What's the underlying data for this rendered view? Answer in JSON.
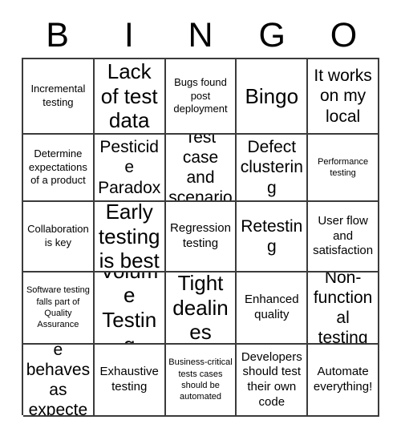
{
  "card": {
    "header_letters": [
      "B",
      "I",
      "N",
      "G",
      "O"
    ],
    "columns": 5,
    "rows": 5,
    "text_color": "#000000",
    "background_color": "#ffffff",
    "border_color": "#3b3b3b",
    "free_space_label": "Bingo",
    "cells": [
      [
        {
          "text": "Incremental testing",
          "size": "sm"
        },
        {
          "text": "Lack of test data",
          "size": "xxl"
        },
        {
          "text": "Bugs found post deployment",
          "size": "sm"
        },
        {
          "text": "Bingo",
          "size": "xxl"
        },
        {
          "text": "It works on my local",
          "size": "xl"
        }
      ],
      [
        {
          "text": "Determine expectations of a product",
          "size": "sm"
        },
        {
          "text": "Pesticide Paradox",
          "size": "xl"
        },
        {
          "text": "Test case and scenario",
          "size": "xl"
        },
        {
          "text": "Defect clustering",
          "size": "xl"
        },
        {
          "text": "Performance testing",
          "size": "xs"
        }
      ],
      [
        {
          "text": "Collaboration is key",
          "size": "sm"
        },
        {
          "text": "Early testing is best",
          "size": "xxl"
        },
        {
          "text": "Regression testing",
          "size": "md"
        },
        {
          "text": "Retesting",
          "size": "xl"
        },
        {
          "text": "User flow and satisfaction",
          "size": "md"
        }
      ],
      [
        {
          "text": "Software testing falls part of Quality Assurance",
          "size": "xs"
        },
        {
          "text": "Volume Testing",
          "size": "xxl"
        },
        {
          "text": "Tight dealines",
          "size": "xxl"
        },
        {
          "text": "Enhanced quality",
          "size": "md"
        },
        {
          "text": "Non-functional testing",
          "size": "xl"
        }
      ],
      [
        {
          "text": "Software behaves as expected",
          "size": "xl"
        },
        {
          "text": "Exhaustive testing",
          "size": "md"
        },
        {
          "text": "Business-critical tests cases should be automated",
          "size": "xs"
        },
        {
          "text": "Developers should test their own code",
          "size": "md"
        },
        {
          "text": "Automate everything!",
          "size": "md"
        }
      ]
    ]
  }
}
